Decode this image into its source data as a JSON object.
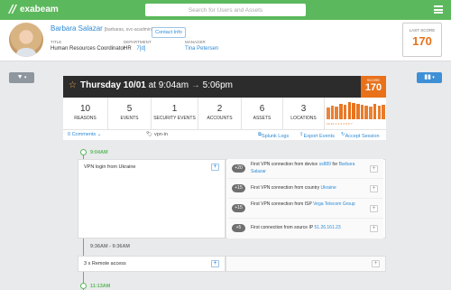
{
  "topbar": {
    "brand": "exabeam",
    "search_placeholder": "Search for Users and Assets",
    "accent": "#5cb85c"
  },
  "profile": {
    "name": "Barbara Salazar",
    "handle": "[barbaras, svc-acadmin]",
    "contact_button": "Contact Info",
    "title_label": "TITLE",
    "title_value": "Human Resources Coordinator",
    "department_label": "DEPARTMENT",
    "department_value": "HR",
    "department_count": "7[d]",
    "manager_label": "MANAGER",
    "manager_value": "Tina Petersen",
    "last_score_label": "LAST SCORE",
    "last_score": "170"
  },
  "session": {
    "day": "Thursday 10/01",
    "at": "at",
    "start": "9:04am",
    "arrow": "→",
    "end": "5:06pm",
    "score_label": "SCORE",
    "score": "170"
  },
  "stats": [
    {
      "value": "10",
      "label": "REASONS"
    },
    {
      "value": "5",
      "label": "EVENTS"
    },
    {
      "value": "1",
      "label": "SECURITY EVENTS"
    },
    {
      "value": "2",
      "label": "ACCOUNTS"
    },
    {
      "value": "6",
      "label": "ASSETS"
    },
    {
      "value": "3",
      "label": "LOCATIONS"
    }
  ],
  "sparkline": {
    "values": [
      14,
      16,
      15,
      18,
      17,
      20,
      19,
      18,
      17,
      16,
      15,
      18,
      16,
      17
    ],
    "color": "#e8711a",
    "axis": "10 12 1 2 3 4 5 6 7"
  },
  "actions": {
    "comments": "0 Comments ⌄",
    "tag": "vpn-in",
    "splunk": "Splunk Logs",
    "export": "Export Events",
    "accept": "Accept Session"
  },
  "timeline": {
    "t1": "9:04AM",
    "t2": "9:36AM - 9:36AM",
    "t3": "11:13AM",
    "card1_title": "VPN login from Ukraine",
    "card2_title": "3 x Remote access"
  },
  "events": [
    {
      "score": "+20",
      "text": "First VPN connection from device ",
      "link1": "ss889",
      "mid": " for ",
      "link2": "Barbara Salazar"
    },
    {
      "score": "+15",
      "text": "First VPN connection from country ",
      "link1": "Ukraine",
      "mid": "",
      "link2": ""
    },
    {
      "score": "+15",
      "text": "First VPN connection from ISP ",
      "link1": "Vega Telecom Group",
      "mid": "",
      "link2": ""
    },
    {
      "score": "+5",
      "text": "First connection from source IP ",
      "link1": "51.26.161.23",
      "mid": "",
      "link2": ""
    }
  ]
}
